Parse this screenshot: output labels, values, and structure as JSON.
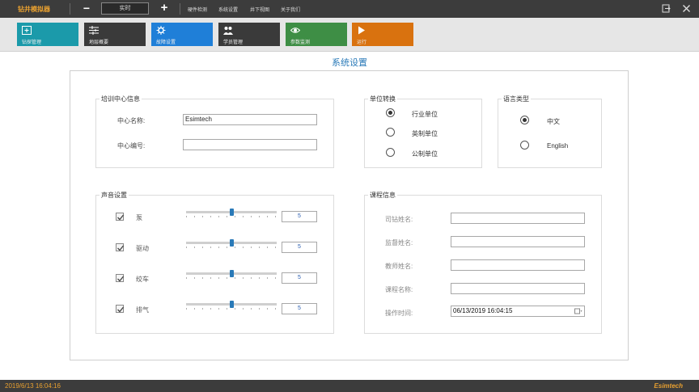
{
  "app": {
    "title": "钻井模拟器",
    "mode_value": "实时",
    "minus_symbol": "−",
    "plus_symbol": "+",
    "menu": [
      "硬件检测",
      "系统设置",
      "井下视图",
      "关于我们"
    ]
  },
  "toolbar": {
    "items": [
      {
        "label": "钻探管理",
        "color": "#1b9aaa",
        "icon": "add-window-icon"
      },
      {
        "label": "地层概要",
        "color": "#3a3a3a",
        "icon": "layers-icon"
      },
      {
        "label": "故障设置",
        "color": "#1f7fd8",
        "icon": "gear-icon"
      },
      {
        "label": "学员管理",
        "color": "#3a3a3a",
        "icon": "users-icon"
      },
      {
        "label": "参数监测",
        "color": "#3e8e45",
        "icon": "eye-icon"
      },
      {
        "label": "运行",
        "color": "#d9720f",
        "icon": "play-icon"
      }
    ]
  },
  "page_title": "系统设置",
  "training_center": {
    "title": "培训中心信息",
    "name_label": "中心名称:",
    "name_value": "Esimtech",
    "code_label": "中心编号:",
    "code_value": ""
  },
  "unit_conversion": {
    "title": "单位转换",
    "options": [
      "行业单位",
      "英制单位",
      "公制单位"
    ],
    "selected_index": 0
  },
  "language": {
    "title": "语言类型",
    "options": [
      "中文",
      "English"
    ],
    "selected_index": 0
  },
  "sound": {
    "title": "声音设置",
    "items": [
      {
        "label": "泵",
        "checked": true,
        "value": "5",
        "level": 0.5
      },
      {
        "label": "驱动",
        "checked": true,
        "value": "5",
        "level": 0.5
      },
      {
        "label": "绞车",
        "checked": true,
        "value": "5",
        "level": 0.5
      },
      {
        "label": "排气",
        "checked": true,
        "value": "5",
        "level": 0.5
      }
    ]
  },
  "course": {
    "title": "课程信息",
    "driller_label": "司钻姓名:",
    "driller_value": "",
    "supervisor_label": "监督姓名:",
    "supervisor_value": "",
    "teacher_label": "教师姓名:",
    "teacher_value": "",
    "course_label": "课程名称:",
    "course_value": "",
    "time_label": "操作时间:",
    "time_value": "06/13/2019 16:04:15"
  },
  "status": {
    "datetime": "2019/6/13 16:04:16",
    "brand": "Esimtech"
  }
}
